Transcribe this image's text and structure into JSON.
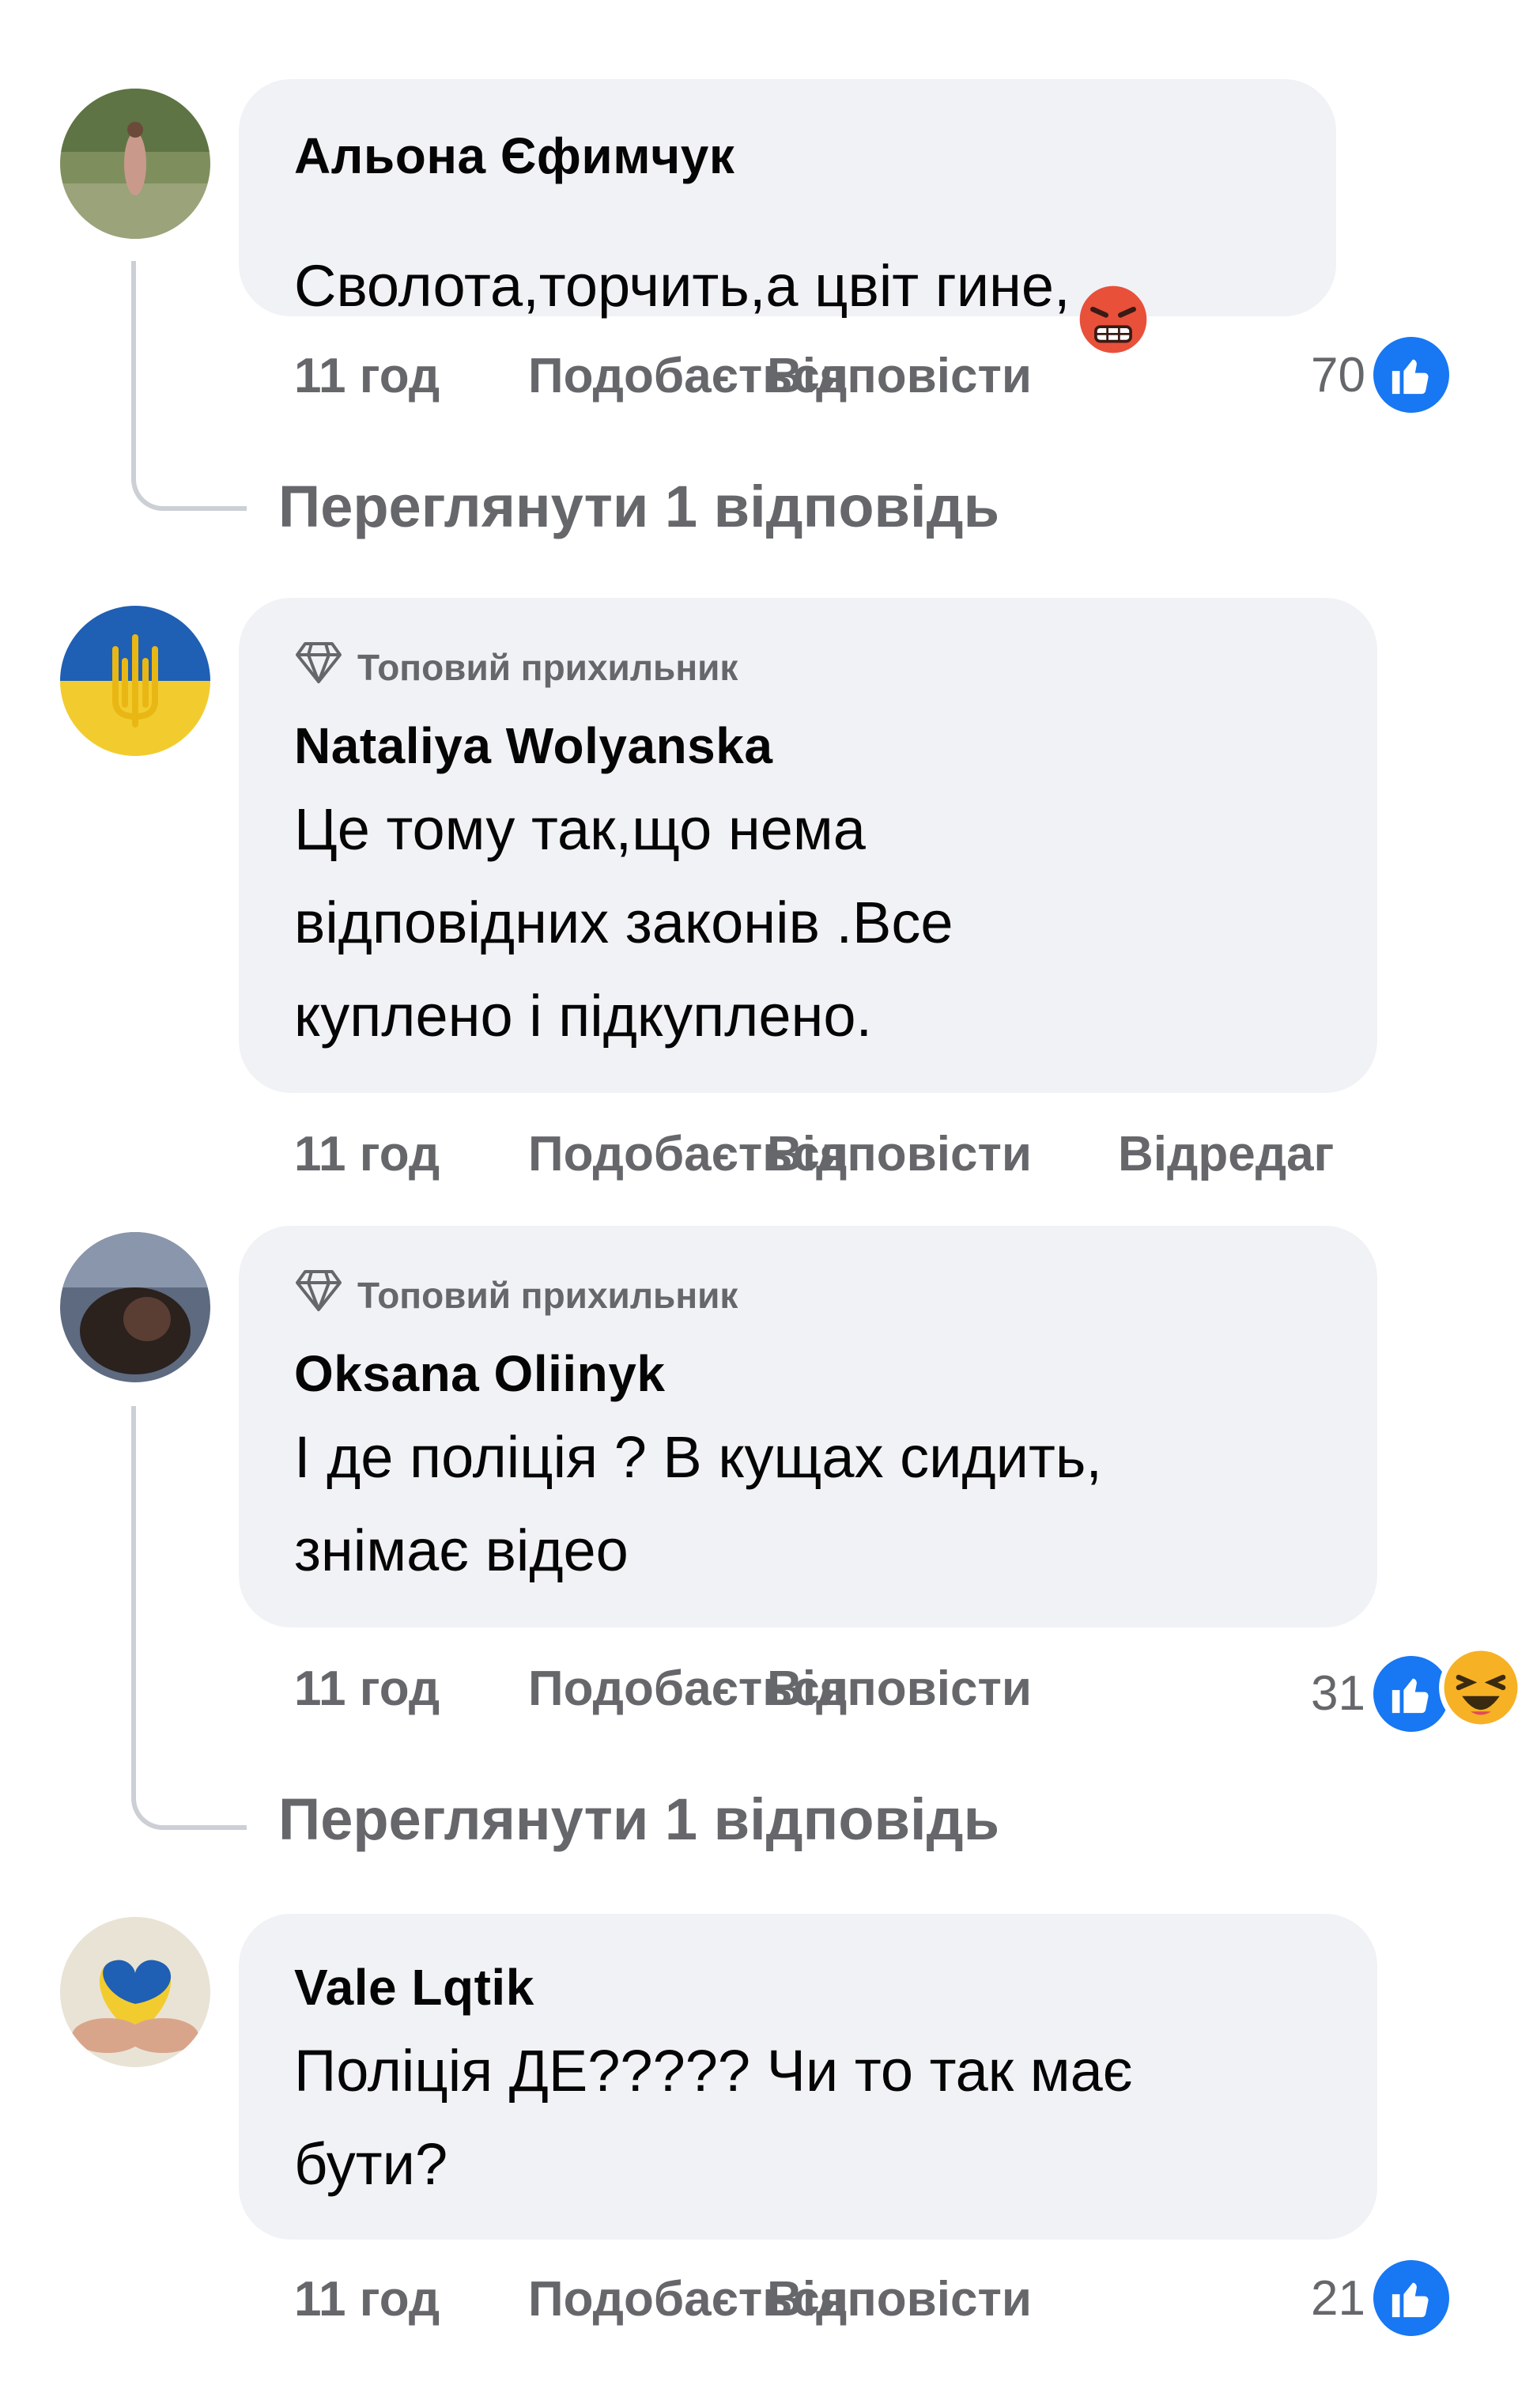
{
  "comments": [
    {
      "author": "Альона Єфимчук",
      "badge": "",
      "text": "Сволота,торчить,а цвіт гине,",
      "emoji": "angry-face-emoji",
      "time": "11 год",
      "like_label": "Подобається",
      "reply_label": "Відповісти",
      "reaction_count": "70",
      "view_replies": "Переглянути 1 відповідь"
    },
    {
      "author": "Nataliya Wolyanska",
      "badge": "Топовий прихильник",
      "text": "Це тому так,що нема\nвідповідних законів .Все\nкуплено і підкуплено.",
      "time": "11 год",
      "like_label": "Подобається",
      "reply_label": "Відповісти",
      "edit_label": "Відредаг"
    },
    {
      "author": "Oksana Oliinyk",
      "badge": "Топовий прихильник",
      "text": "І де поліція ? В кущах сидить,\nзнімає відео",
      "time": "11 год",
      "like_label": "Подобається",
      "reply_label": "Відповісти",
      "reaction_count": "31",
      "view_replies": "Переглянути 1 відповідь"
    },
    {
      "author": "Vale Lqtik",
      "badge": "",
      "text": "Поліція ДЕ????? Чи то так має\nбути?",
      "time": "11 год",
      "like_label": "Подобається",
      "reply_label": "Відповісти",
      "reaction_count": "21"
    }
  ],
  "colors": {
    "bubble": "#f0f2f5",
    "meta_text": "#65676b",
    "like_blue": "#1877f2",
    "thread_line": "#ccd0d5"
  }
}
